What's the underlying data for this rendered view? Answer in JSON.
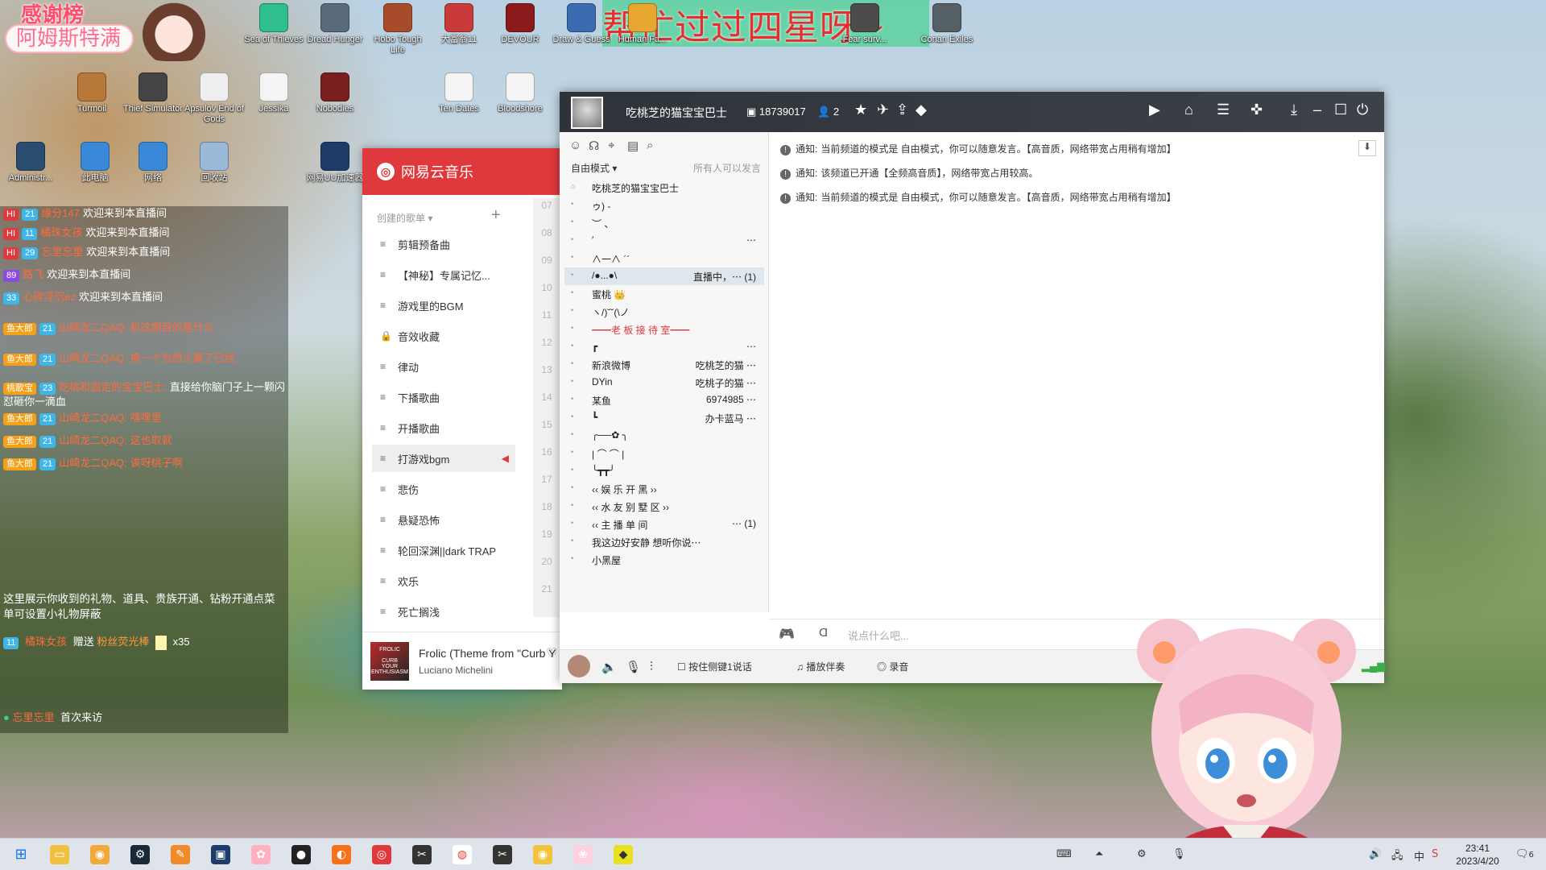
{
  "banner": {
    "text": "帮忙过过四星呀~"
  },
  "thanks_board": {
    "title": "感谢榜",
    "name": "阿姆斯特满"
  },
  "desktop_icons": [
    {
      "label": "Sea of Thieves",
      "color": "#2fbf8f"
    },
    {
      "label": "Dread Hunger",
      "color": "#5a6a7c"
    },
    {
      "label": "Hobo Tough Life",
      "color": "#a84b2a"
    },
    {
      "label": "大富翁11",
      "color": "#c93a3a"
    },
    {
      "label": "DEVOUR",
      "color": "#8b1b1b"
    },
    {
      "label": "Draw & Guess",
      "color": "#3b6bb0"
    },
    {
      "label": "Human Fa...",
      "color": "#e7a630"
    },
    {
      "label": "Fear surv...",
      "color": "#4b4b4b"
    },
    {
      "label": "Conan Exiles",
      "color": "#556066"
    },
    {
      "label": "Turmoil",
      "color": "#b7783a"
    },
    {
      "label": "Thief Simulator",
      "color": "#444"
    },
    {
      "label": "Apsulov End of Gods",
      "color": "#eeeeee"
    },
    {
      "label": "Jessika",
      "color": "#f4f4f4"
    },
    {
      "label": "Nobodies",
      "color": "#7a1f1f"
    },
    {
      "label": "Ten Dates",
      "color": "#f4f4f4"
    },
    {
      "label": "Bloodshore",
      "color": "#f4f4f4"
    },
    {
      "label": "Administr...",
      "color": "#2a4c6e"
    },
    {
      "label": "此电脑",
      "color": "#3a88d8"
    },
    {
      "label": "网络",
      "color": "#3a88d8"
    },
    {
      "label": "回收站",
      "color": "#9bb9d8"
    },
    {
      "label": "网易UU加速器",
      "color": "#1d3c6a"
    }
  ],
  "chat": {
    "rows": [
      {
        "badge": "HI",
        "level": "21",
        "name": "缘分147",
        "text": "欢迎来到本直播间"
      },
      {
        "badge": "HI",
        "level": "11",
        "name": "橘珠女孩",
        "text": "欢迎来到本直播间"
      },
      {
        "badge": "HI",
        "level": "29",
        "name": "忘里忘里",
        "text": "欢迎来到本直播间"
      },
      {
        "badge": "",
        "level": "89",
        "name": "路飞",
        "text": "欢迎来到本直播间"
      },
      {
        "badge": "",
        "level": "33",
        "name": "心碎浮沉ez",
        "text": "欢迎来到本直播间"
      },
      {
        "badge": "鱼大郎",
        "level": "21",
        "name": "山崎龙二QAQ:",
        "text": "机这期目的是什么"
      },
      {
        "badge": "鱼大郎",
        "level": "21",
        "name": "山崎龙二QAQ:",
        "text": "换一个包想火赢了已经"
      },
      {
        "badge": "桃歌宝",
        "level": "23",
        "name": "吃桃和固定的宝宝巴士:",
        "text": "直接给你脑门子上一颗闪 怼砸你一滴血"
      },
      {
        "badge": "鱼大郎",
        "level": "21",
        "name": "山崎龙二QAQ:",
        "text": "嘿嘿里"
      },
      {
        "badge": "鱼大郎",
        "level": "21",
        "name": "山崎龙二QAQ:",
        "text": "这也取就"
      },
      {
        "badge": "鱼大郎",
        "level": "21",
        "name": "山崎龙二QAQ:",
        "text": "诶呀桃子啊"
      }
    ],
    "note": "这里展示你收到的礼物、道具、贵族开通、钻粉开通点菜单可设置小礼物屏蔽",
    "gift": {
      "level": "11",
      "name": "橘珠女孩",
      "action": "赠送",
      "item": "粉丝荧光棒",
      "count": "x35"
    },
    "first": {
      "name": "忘里忘里",
      "text": "首次来访"
    }
  },
  "music": {
    "app_name": "网易云音乐",
    "section_title": "创建的歌单",
    "playlists": [
      "剪辑预备曲",
      "【神秘】专属记忆...",
      "游戏里的BGM",
      "音效收藏",
      "律动",
      "下播歌曲",
      "开播歌曲",
      "打游戏bgm",
      "悲伤",
      "悬疑恐怖",
      "轮回深渊||dark TRAP",
      "欢乐",
      "死亡搁浅"
    ],
    "active_playlist": "打游戏bgm",
    "now_playing": {
      "song": "Frolic (Theme from \"Curb Your Enthusiasm\")",
      "artist": "Luciano Michelini"
    },
    "line_numbers": [
      "07",
      "08",
      "09",
      "10",
      "11",
      "12",
      "13",
      "14",
      "15",
      "16",
      "17",
      "18",
      "19",
      "20",
      "21"
    ]
  },
  "yy": {
    "channel_title": "吃桃芝的猫宝宝巴士",
    "channel_id": "18739017",
    "user_count": "2",
    "mode": "自由模式",
    "speak_permission": "所有人可以发言",
    "channels": [
      {
        "name": "吃桃芝的猫宝宝巴士",
        "right": ""
      },
      {
        "name": "ゥ) -",
        "right": ""
      },
      {
        "name": "︶ 、",
        "right": ""
      },
      {
        "name": "′",
        "right": "⋯"
      },
      {
        "name": "∧一∧ ´´",
        "right": ""
      },
      {
        "name": "/●...●\\",
        "right": "直播中，⋯ (1)"
      },
      {
        "name": "蜜桃 👑",
        "right": ""
      },
      {
        "name": "ヽ/)˘˘(\\ノ",
        "right": ""
      },
      {
        "name": "━━老 板 接 待 室━━",
        "right": ""
      },
      {
        "name": "┏",
        "right": "⋯"
      },
      {
        "name": "新浪微博",
        "right": "吃桃芝的猫 ⋯"
      },
      {
        "name": "DYin",
        "right": "吃桃子的猫 ⋯"
      },
      {
        "name": "某鱼",
        "right": "6974985 ⋯"
      },
      {
        "name": "┗",
        "right": "办卡蓝马 ⋯"
      },
      {
        "name": "╭──✿ ╮",
        "right": ""
      },
      {
        "name": "| ⌒ ⌒ |",
        "right": ""
      },
      {
        "name": "╰┳┳╯",
        "right": ""
      },
      {
        "name": "‹‹ 娱 乐 开 黑 ››",
        "right": ""
      },
      {
        "name": "‹‹ 水 友 别 墅 区 ››",
        "right": ""
      },
      {
        "name": "‹‹ 主 播 单 间",
        "right": "⋯ (1)"
      },
      {
        "name": "我这边好安静 想听你说⋯",
        "right": ""
      },
      {
        "name": "小黑屋",
        "right": ""
      }
    ],
    "notices": [
      {
        "label": "通知:",
        "text": "当前频道的模式是 自由模式，你可以随意发言。【高音质，网络带宽占用稍有增加】"
      },
      {
        "label": "通知:",
        "text": "该频道已开通【全频高音质】，网络带宽占用较高。"
      },
      {
        "label": "通知:",
        "text": "当前频道的模式是 自由模式，你可以随意发言。【高音质，网络带宽占用稍有增加】"
      }
    ],
    "input_placeholder": "说点什么吧...",
    "bottom": {
      "ptt": "按住侧键1说话",
      "accompany": "播放伴奏",
      "record": "录音"
    }
  },
  "taskbar": {
    "time": "23:41",
    "date": "2023/4/20",
    "notifications": "6"
  }
}
